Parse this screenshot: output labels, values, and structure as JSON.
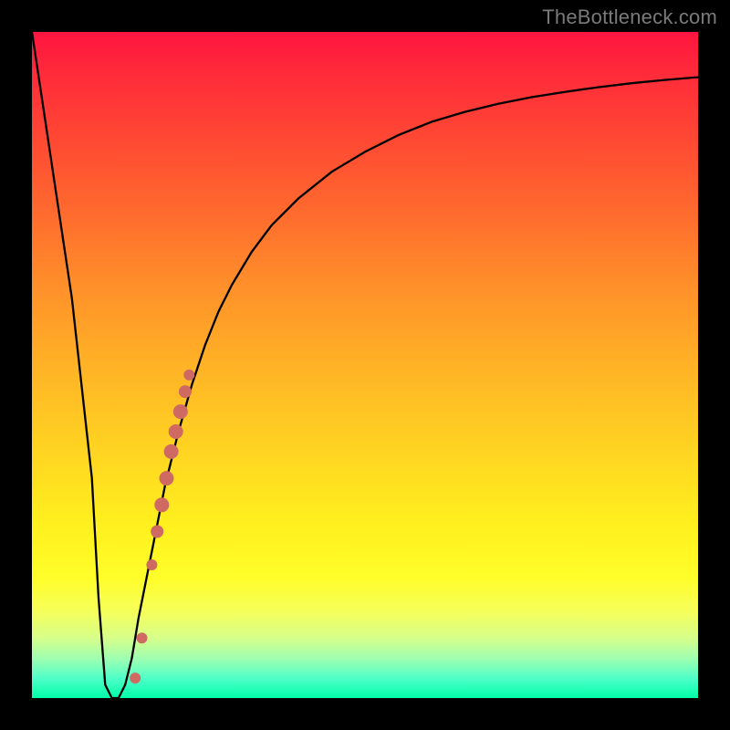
{
  "watermark": "TheBottleneck.com",
  "colors": {
    "frame": "#000000",
    "curve": "#000000",
    "marker": "#cf6a63",
    "watermark": "#7a7a7a"
  },
  "chart_data": {
    "type": "line",
    "title": "",
    "xlabel": "",
    "ylabel": "",
    "xlim": [
      0,
      100
    ],
    "ylim": [
      0,
      100
    ],
    "grid": false,
    "series": [
      {
        "name": "bottleneck-curve",
        "x": [
          0,
          3,
          6,
          9,
          10,
          11,
          12,
          13,
          14,
          15,
          16,
          18,
          20,
          22,
          24,
          26,
          28,
          30,
          33,
          36,
          40,
          45,
          50,
          55,
          60,
          65,
          70,
          75,
          80,
          85,
          90,
          95,
          100
        ],
        "y": [
          100,
          80,
          60,
          33,
          15,
          2,
          0,
          0,
          2,
          6,
          12,
          22,
          32,
          40,
          47,
          53,
          58,
          62,
          67,
          71,
          75,
          79,
          82,
          84.5,
          86.5,
          88,
          89.2,
          90.2,
          91,
          91.7,
          92.3,
          92.8,
          93.2
        ]
      }
    ],
    "markers": [
      {
        "x": 15.5,
        "y": 3,
        "r": 6
      },
      {
        "x": 16.5,
        "y": 9,
        "r": 6
      },
      {
        "x": 18.0,
        "y": 20,
        "r": 6
      },
      {
        "x": 18.8,
        "y": 25,
        "r": 7
      },
      {
        "x": 19.5,
        "y": 29,
        "r": 8
      },
      {
        "x": 20.2,
        "y": 33,
        "r": 8
      },
      {
        "x": 20.9,
        "y": 37,
        "r": 8
      },
      {
        "x": 21.6,
        "y": 40,
        "r": 8
      },
      {
        "x": 22.3,
        "y": 43,
        "r": 8
      },
      {
        "x": 23.0,
        "y": 46,
        "r": 7
      },
      {
        "x": 23.6,
        "y": 48.5,
        "r": 6
      }
    ]
  }
}
